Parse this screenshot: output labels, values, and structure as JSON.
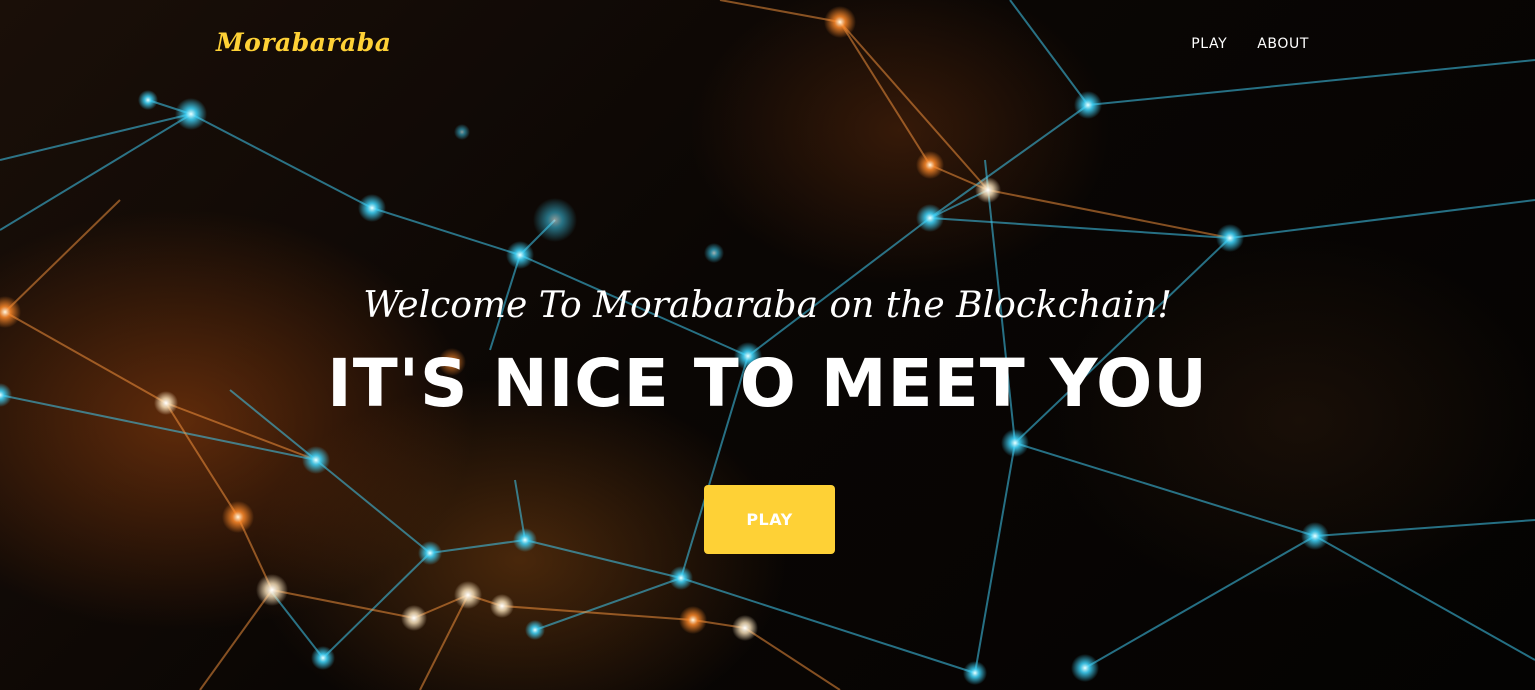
{
  "navbar": {
    "brand": "Morabaraba",
    "links": [
      {
        "label": "PLAY"
      },
      {
        "label": "ABOUT"
      }
    ]
  },
  "intro": {
    "lead_in": "Welcome To Morabaraba on the Blockchain!",
    "heading": "IT'S NICE TO MEET YOU",
    "cta_label": "PLAY"
  },
  "colors": {
    "accent": "#fed136",
    "text": "#ffffff",
    "background": "#050403",
    "network_cyan": "#3fd8ff",
    "network_orange": "#ff8a2a"
  }
}
